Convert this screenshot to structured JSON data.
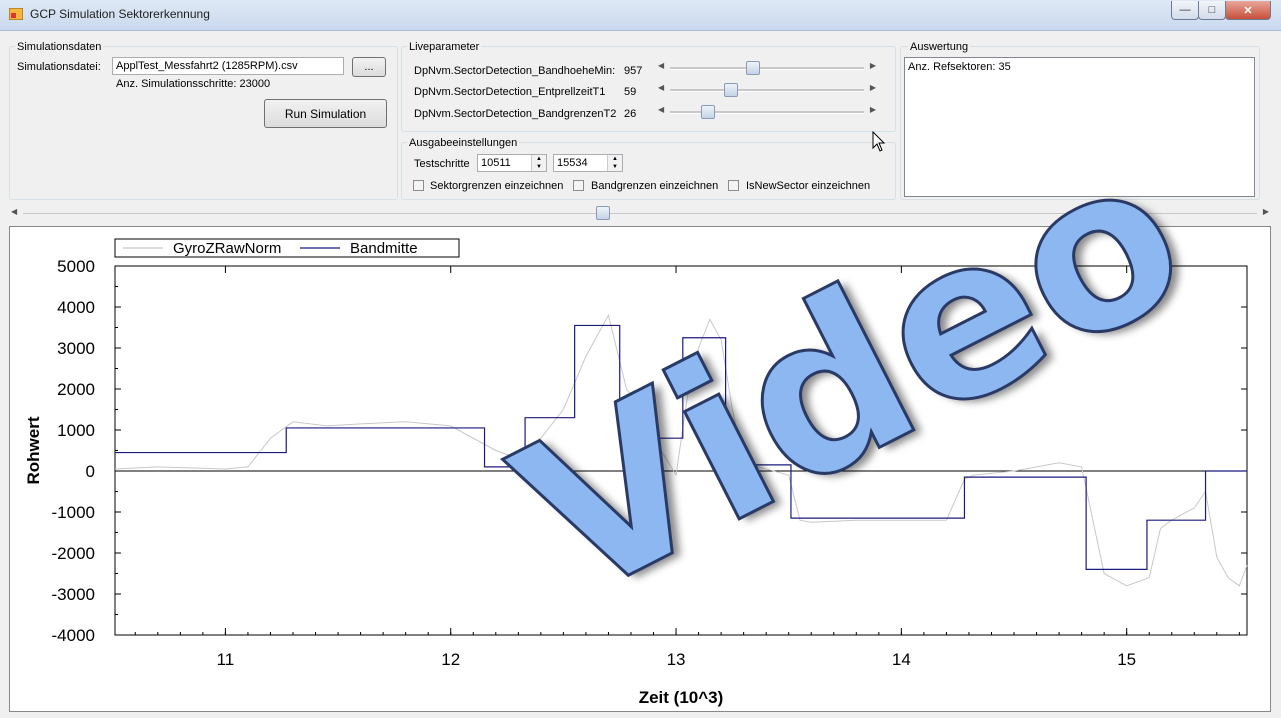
{
  "window": {
    "title": "GCP Simulation Sektorerkennung",
    "icon": "app-icon",
    "controls": [
      "minimize-icon",
      "maximize-icon",
      "close-icon"
    ]
  },
  "sim": {
    "group_label": "Simulationsdaten",
    "file_label": "Simulationsdatei:",
    "file_value": "ApplTest_Messfahrt2 (1285RPM).csv",
    "browse_label": "...",
    "steps_label": "Anz. Simulationsschritte: 23000",
    "run_label": "Run Simulation"
  },
  "live": {
    "group_label": "Liveparameter",
    "params": [
      {
        "name": "DpNvm.SectorDetection_BandhoeheMin:",
        "value": "957",
        "level": 0.42
      },
      {
        "name": "DpNvm.SectorDetection_EntprellzeitT1",
        "value": "59",
        "level": 0.3
      },
      {
        "name": "DpNvm.SectorDetection_BandgrenzenT2",
        "value": "26",
        "level": 0.17
      }
    ]
  },
  "output": {
    "group_label": "Ausgabeeinstellungen",
    "steps_label": "Testschritte",
    "from_value": "10511",
    "to_value": "15534",
    "checkboxes": [
      {
        "label": "Sektorgrenzen einzeichnen",
        "checked": false
      },
      {
        "label": "Bandgrenzen einzeichnen",
        "checked": false
      },
      {
        "label": "IsNewSector einzeichnen",
        "checked": false
      }
    ]
  },
  "eval": {
    "group_label": "Auswertung",
    "text": "Anz. Refsektoren: 35"
  },
  "splitter_level": 0.47,
  "watermark": "Video",
  "chart_data": {
    "type": "line",
    "title": "",
    "xlabel": "Zeit (10^3)",
    "ylabel": "Rohwert",
    "xlim": [
      10.51,
      15.534
    ],
    "ylim": [
      -4000,
      5000
    ],
    "x_ticks": [
      11,
      12,
      13,
      14,
      15
    ],
    "y_ticks": [
      5000,
      4000,
      3000,
      2000,
      1000,
      0,
      -1000,
      -2000,
      -3000,
      -4000
    ],
    "grid": false,
    "legend": "top-left",
    "series": [
      {
        "name": "GyroZRawNorm",
        "color": "#c8c8c8",
        "x": [
          10.51,
          10.7,
          11.0,
          11.1,
          11.2,
          11.3,
          11.45,
          11.6,
          11.8,
          12.0,
          12.2,
          12.3,
          12.4,
          12.5,
          12.6,
          12.7,
          12.78,
          12.85,
          12.9,
          13.0,
          13.05,
          13.1,
          13.15,
          13.2,
          13.25,
          13.3,
          13.4,
          13.5,
          13.55,
          13.6,
          13.8,
          14.0,
          14.2,
          14.28,
          14.32,
          14.5,
          14.7,
          14.8,
          14.85,
          14.9,
          15.0,
          15.1,
          15.15,
          15.2,
          15.3,
          15.35,
          15.4,
          15.45,
          15.5,
          15.534
        ],
        "y": [
          50,
          100,
          50,
          100,
          800,
          1200,
          1100,
          1150,
          1200,
          1100,
          500,
          300,
          800,
          1500,
          2800,
          3800,
          2000,
          1500,
          800,
          -100,
          1800,
          3000,
          3700,
          3200,
          1500,
          200,
          50,
          -100,
          -1200,
          -1250,
          -1200,
          -1200,
          -1200,
          -200,
          -100,
          0,
          200,
          100,
          -1200,
          -2500,
          -2800,
          -2600,
          -1400,
          -1200,
          -900,
          -500,
          -2100,
          -2600,
          -2800,
          -2300
        ]
      },
      {
        "name": "Bandmitte",
        "color": "#1a1a80",
        "x": [
          10.51,
          11.27,
          11.27,
          12.15,
          12.15,
          12.33,
          12.33,
          12.55,
          12.55,
          12.75,
          12.75,
          13.03,
          13.03,
          13.22,
          13.22,
          13.51,
          13.51,
          14.28,
          14.28,
          14.82,
          14.82,
          15.09,
          15.09,
          15.35,
          15.35,
          15.534
        ],
        "y": [
          450,
          450,
          1050,
          1050,
          100,
          100,
          1300,
          1300,
          3550,
          3550,
          800,
          800,
          3250,
          3250,
          150,
          150,
          -1150,
          -1150,
          -150,
          -150,
          -2400,
          -2400,
          -1200,
          -1200,
          0,
          0
        ]
      }
    ]
  }
}
